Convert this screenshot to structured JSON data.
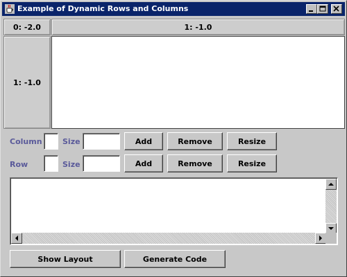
{
  "window": {
    "title": "Example of Dynamic Rows and Columns"
  },
  "grid": {
    "corner_label": "0: -2.0",
    "column_header": "1: -1.0",
    "row_header": "1: -1.0"
  },
  "column_row": {
    "label": "Column",
    "index_value": "",
    "size_label": "Size",
    "size_value": "",
    "add_label": "Add",
    "remove_label": "Remove",
    "resize_label": "Resize"
  },
  "row_row": {
    "label": "Row",
    "index_value": "",
    "size_label": "Size",
    "size_value": "",
    "add_label": "Add",
    "remove_label": "Remove",
    "resize_label": "Resize"
  },
  "output": {
    "text": ""
  },
  "footer": {
    "show_layout_label": "Show Layout",
    "generate_code_label": "Generate Code"
  },
  "icons": [
    "java-cup-icon",
    "minimize-icon",
    "maximize-icon",
    "close-icon",
    "scroll-up-icon",
    "scroll-down-icon",
    "scroll-left-icon",
    "scroll-right-icon"
  ],
  "colors": {
    "titlebar": "#0a246a",
    "label_text": "#5a5a9a",
    "background": "#c8c8c8"
  }
}
